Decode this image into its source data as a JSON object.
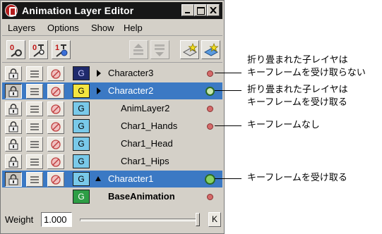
{
  "window": {
    "title": "Animation Layer Editor"
  },
  "menu": {
    "items": [
      "Layers",
      "Options",
      "Show",
      "Help"
    ]
  },
  "toolbar": {
    "buttons": [
      {
        "icon": "key-zero-icon"
      },
      {
        "icon": "key-zero-weight-icon"
      },
      {
        "icon": "key-one-weight-icon"
      },
      {
        "icon": "move-layer-up-icon",
        "enabled": false
      },
      {
        "icon": "move-layer-down-icon",
        "enabled": false
      },
      {
        "icon": "create-empty-layer-icon"
      },
      {
        "icon": "create-layer-from-selected-icon"
      }
    ]
  },
  "layers": [
    {
      "name": "Character3",
      "ghost": "G",
      "ghost_color": "dark",
      "arrow": "right",
      "selected": false,
      "indent": false,
      "dot": "small"
    },
    {
      "name": "Character2",
      "ghost": "G",
      "ghost_color": "yellow",
      "arrow": "right",
      "selected": true,
      "indent": false,
      "dot": "ring"
    },
    {
      "name": "AnimLayer2",
      "ghost": "G",
      "ghost_color": "cyan",
      "arrow": "",
      "selected": false,
      "indent": true,
      "dot": "small"
    },
    {
      "name": "Char1_Hands",
      "ghost": "G",
      "ghost_color": "cyan",
      "arrow": "",
      "selected": false,
      "indent": true,
      "dot": "small"
    },
    {
      "name": "Char1_Head",
      "ghost": "G",
      "ghost_color": "cyan",
      "arrow": "",
      "selected": false,
      "indent": true,
      "dot": ""
    },
    {
      "name": "Char1_Hips",
      "ghost": "G",
      "ghost_color": "cyan",
      "arrow": "",
      "selected": false,
      "indent": true,
      "dot": ""
    },
    {
      "name": "Character1",
      "ghost": "G",
      "ghost_color": "cyan",
      "arrow": "up",
      "selected": true,
      "indent": false,
      "dot": "big"
    },
    {
      "name": "BaseAnimation",
      "ghost": "G",
      "ghost_color": "green",
      "arrow": "",
      "selected": false,
      "indent": false,
      "dot": "small",
      "bold": true,
      "base": true
    }
  ],
  "weight": {
    "label": "Weight",
    "value": "1.000",
    "slider": 1.0,
    "key_label": "K"
  },
  "annotations": [
    {
      "lines": [
        "折り畳まれた子レイヤは",
        "キーフレームを受け取らない"
      ]
    },
    {
      "lines": [
        "折り畳まれた子レイヤは",
        "キーフレームを受け取る"
      ]
    },
    {
      "lines": [
        "キーフレームなし"
      ]
    },
    {
      "lines": [
        "キーフレームを受け取る"
      ]
    }
  ]
}
